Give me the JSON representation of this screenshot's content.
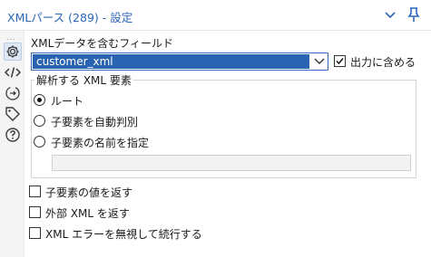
{
  "header": {
    "title": "XMLパース (289) - 設定",
    "collapse_icon": "chevron-down-icon",
    "pin_icon": "pin-icon"
  },
  "rail": {
    "more": "...",
    "icons": [
      "gear-icon",
      "code-icon",
      "connection-icon",
      "tag-icon",
      "help-icon"
    ]
  },
  "form": {
    "field_label": "XMLデータを含むフィールド",
    "field_value": "customer_xml",
    "include_in_output_label": "出力に含める",
    "include_in_output_checked": true,
    "group": {
      "title": "解析する XML 要素",
      "options": [
        {
          "label": "ルート",
          "selected": true
        },
        {
          "label": "子要素を自動判別",
          "selected": false
        },
        {
          "label": "子要素の名前を指定",
          "selected": false
        }
      ],
      "child_name_value": ""
    },
    "checkboxes": [
      {
        "label": "子要素の値を返す",
        "checked": false
      },
      {
        "label": "外部 XML を返す",
        "checked": false
      },
      {
        "label": "XML エラーを無視して続行する",
        "checked": false
      }
    ]
  },
  "colors": {
    "accent": "#2d66b8",
    "selection": "#2b63b3"
  }
}
